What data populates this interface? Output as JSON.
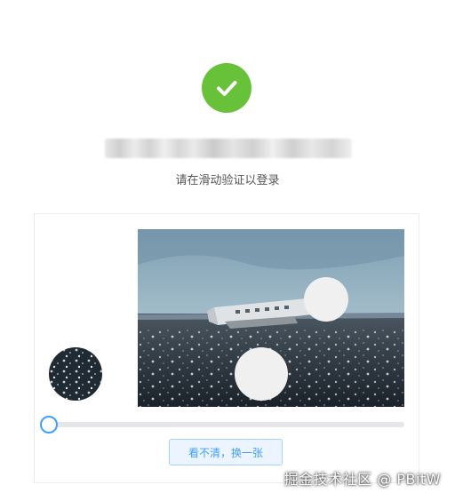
{
  "success": {
    "icon": "checkmark-icon",
    "color": "#67c23a"
  },
  "account": {
    "masked_text": "",
    "blurred": true
  },
  "captcha": {
    "hint": "请在滑动验证以登录",
    "image_alt": "Plane wreck on black sand beach",
    "slider": {
      "progress": 0,
      "accent": "#409eff"
    },
    "refresh_label": "看不清，换一张"
  },
  "watermark": {
    "text": "掘金技术社区 @ PBitW"
  }
}
